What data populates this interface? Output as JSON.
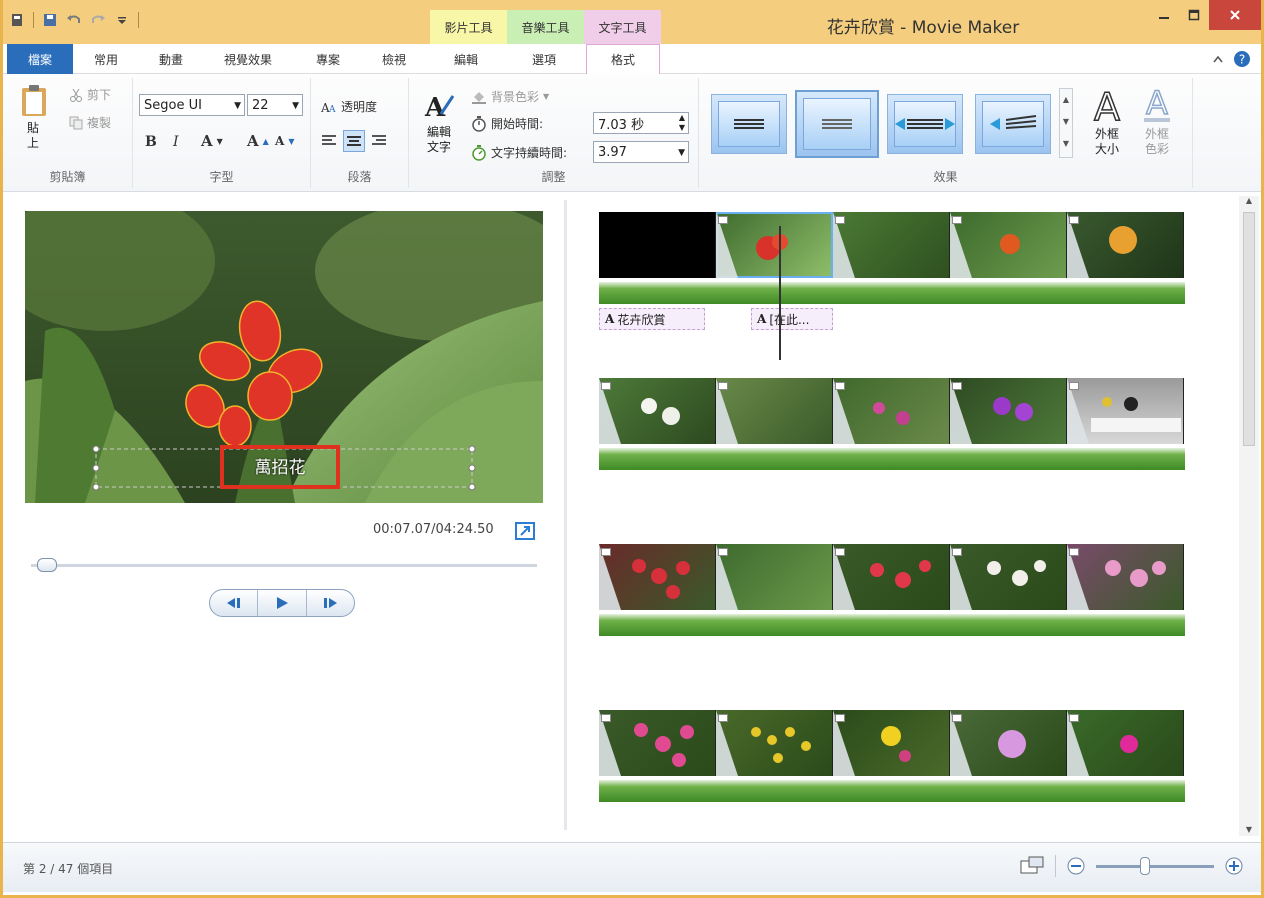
{
  "window": {
    "title": "花卉欣賞 - Movie Maker",
    "context_tabs": [
      "影片工具",
      "音樂工具",
      "文字工具"
    ]
  },
  "tabs": {
    "file": "檔案",
    "items": [
      "常用",
      "動畫",
      "視覺效果",
      "專案",
      "檢視",
      "編輯",
      "選項",
      "格式"
    ]
  },
  "ribbon": {
    "clipboard": {
      "paste": "貼上",
      "cut": "剪下",
      "copy": "複製",
      "label": "剪貼簿"
    },
    "font": {
      "family": "Segoe UI",
      "size": "22",
      "bold": "B",
      "italic": "I",
      "color": "A",
      "grow": "A",
      "shrink": "A",
      "label": "字型"
    },
    "paragraph": {
      "transparency": "透明度",
      "label": "段落"
    },
    "adjust": {
      "edit_text": "編輯文字",
      "bg_color": "背景色彩",
      "start_time_label": "開始時間:",
      "start_time_value": "7.03 秒",
      "duration_label": "文字持續時間:",
      "duration_value": "3.97",
      "label": "調整"
    },
    "effects": {
      "outline_size": "外框大小",
      "outline_color": "外框色彩",
      "label": "效果"
    }
  },
  "preview": {
    "caption_text": "萬招花",
    "timecode": "00:07.07/04:24.50"
  },
  "storyboard": {
    "captions": [
      "花卉欣賞",
      "[在此..."
    ]
  },
  "status": {
    "text": "第 2 / 47 個項目"
  },
  "colors": {
    "accent": "#2a6ebb",
    "title_bar": "#f4ce7e",
    "highlight_box": "#e0301e",
    "audio_track": "#4f9a32"
  }
}
